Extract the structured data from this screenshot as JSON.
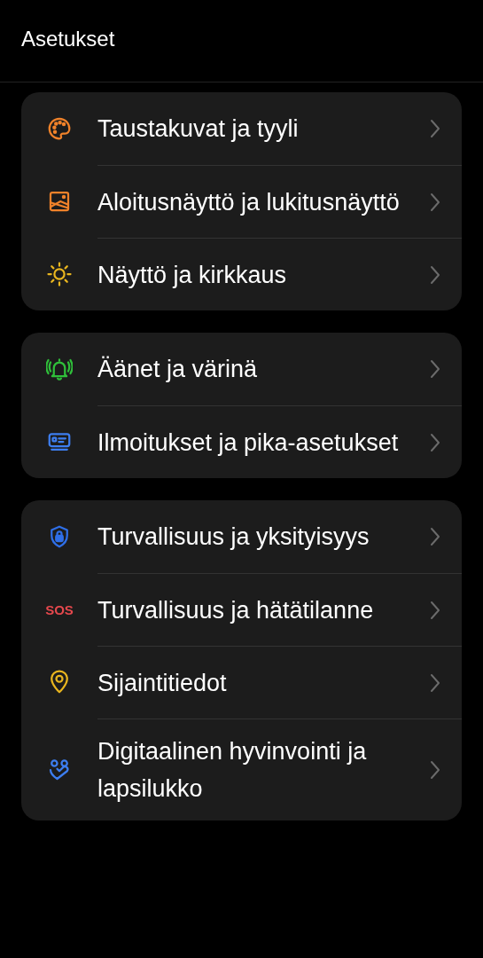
{
  "header": {
    "title": "Asetukset"
  },
  "groups": [
    {
      "items": [
        {
          "kind": "palette",
          "label": "Taustakuvat ja tyyli"
        },
        {
          "kind": "picture-frame",
          "label": "Aloitusnäyttö ja lukitusnäyttö"
        },
        {
          "kind": "sun",
          "label": "Näyttö ja kirkkaus"
        }
      ]
    },
    {
      "items": [
        {
          "kind": "bell",
          "label": "Äänet ja värinä"
        },
        {
          "kind": "panel",
          "label": "Ilmoitukset ja pika-asetukset"
        }
      ]
    },
    {
      "items": [
        {
          "kind": "shield",
          "label": "Turvallisuus ja yksityisyys"
        },
        {
          "kind": "text-icon",
          "icon_text": "SOS",
          "label": "Turvallisuus ja hätätilanne"
        },
        {
          "kind": "pin",
          "label": "Sijaintitiedot"
        },
        {
          "kind": "people",
          "label": "Digitaalinen hyvinvointi ja lapsilukko"
        }
      ]
    }
  ]
}
